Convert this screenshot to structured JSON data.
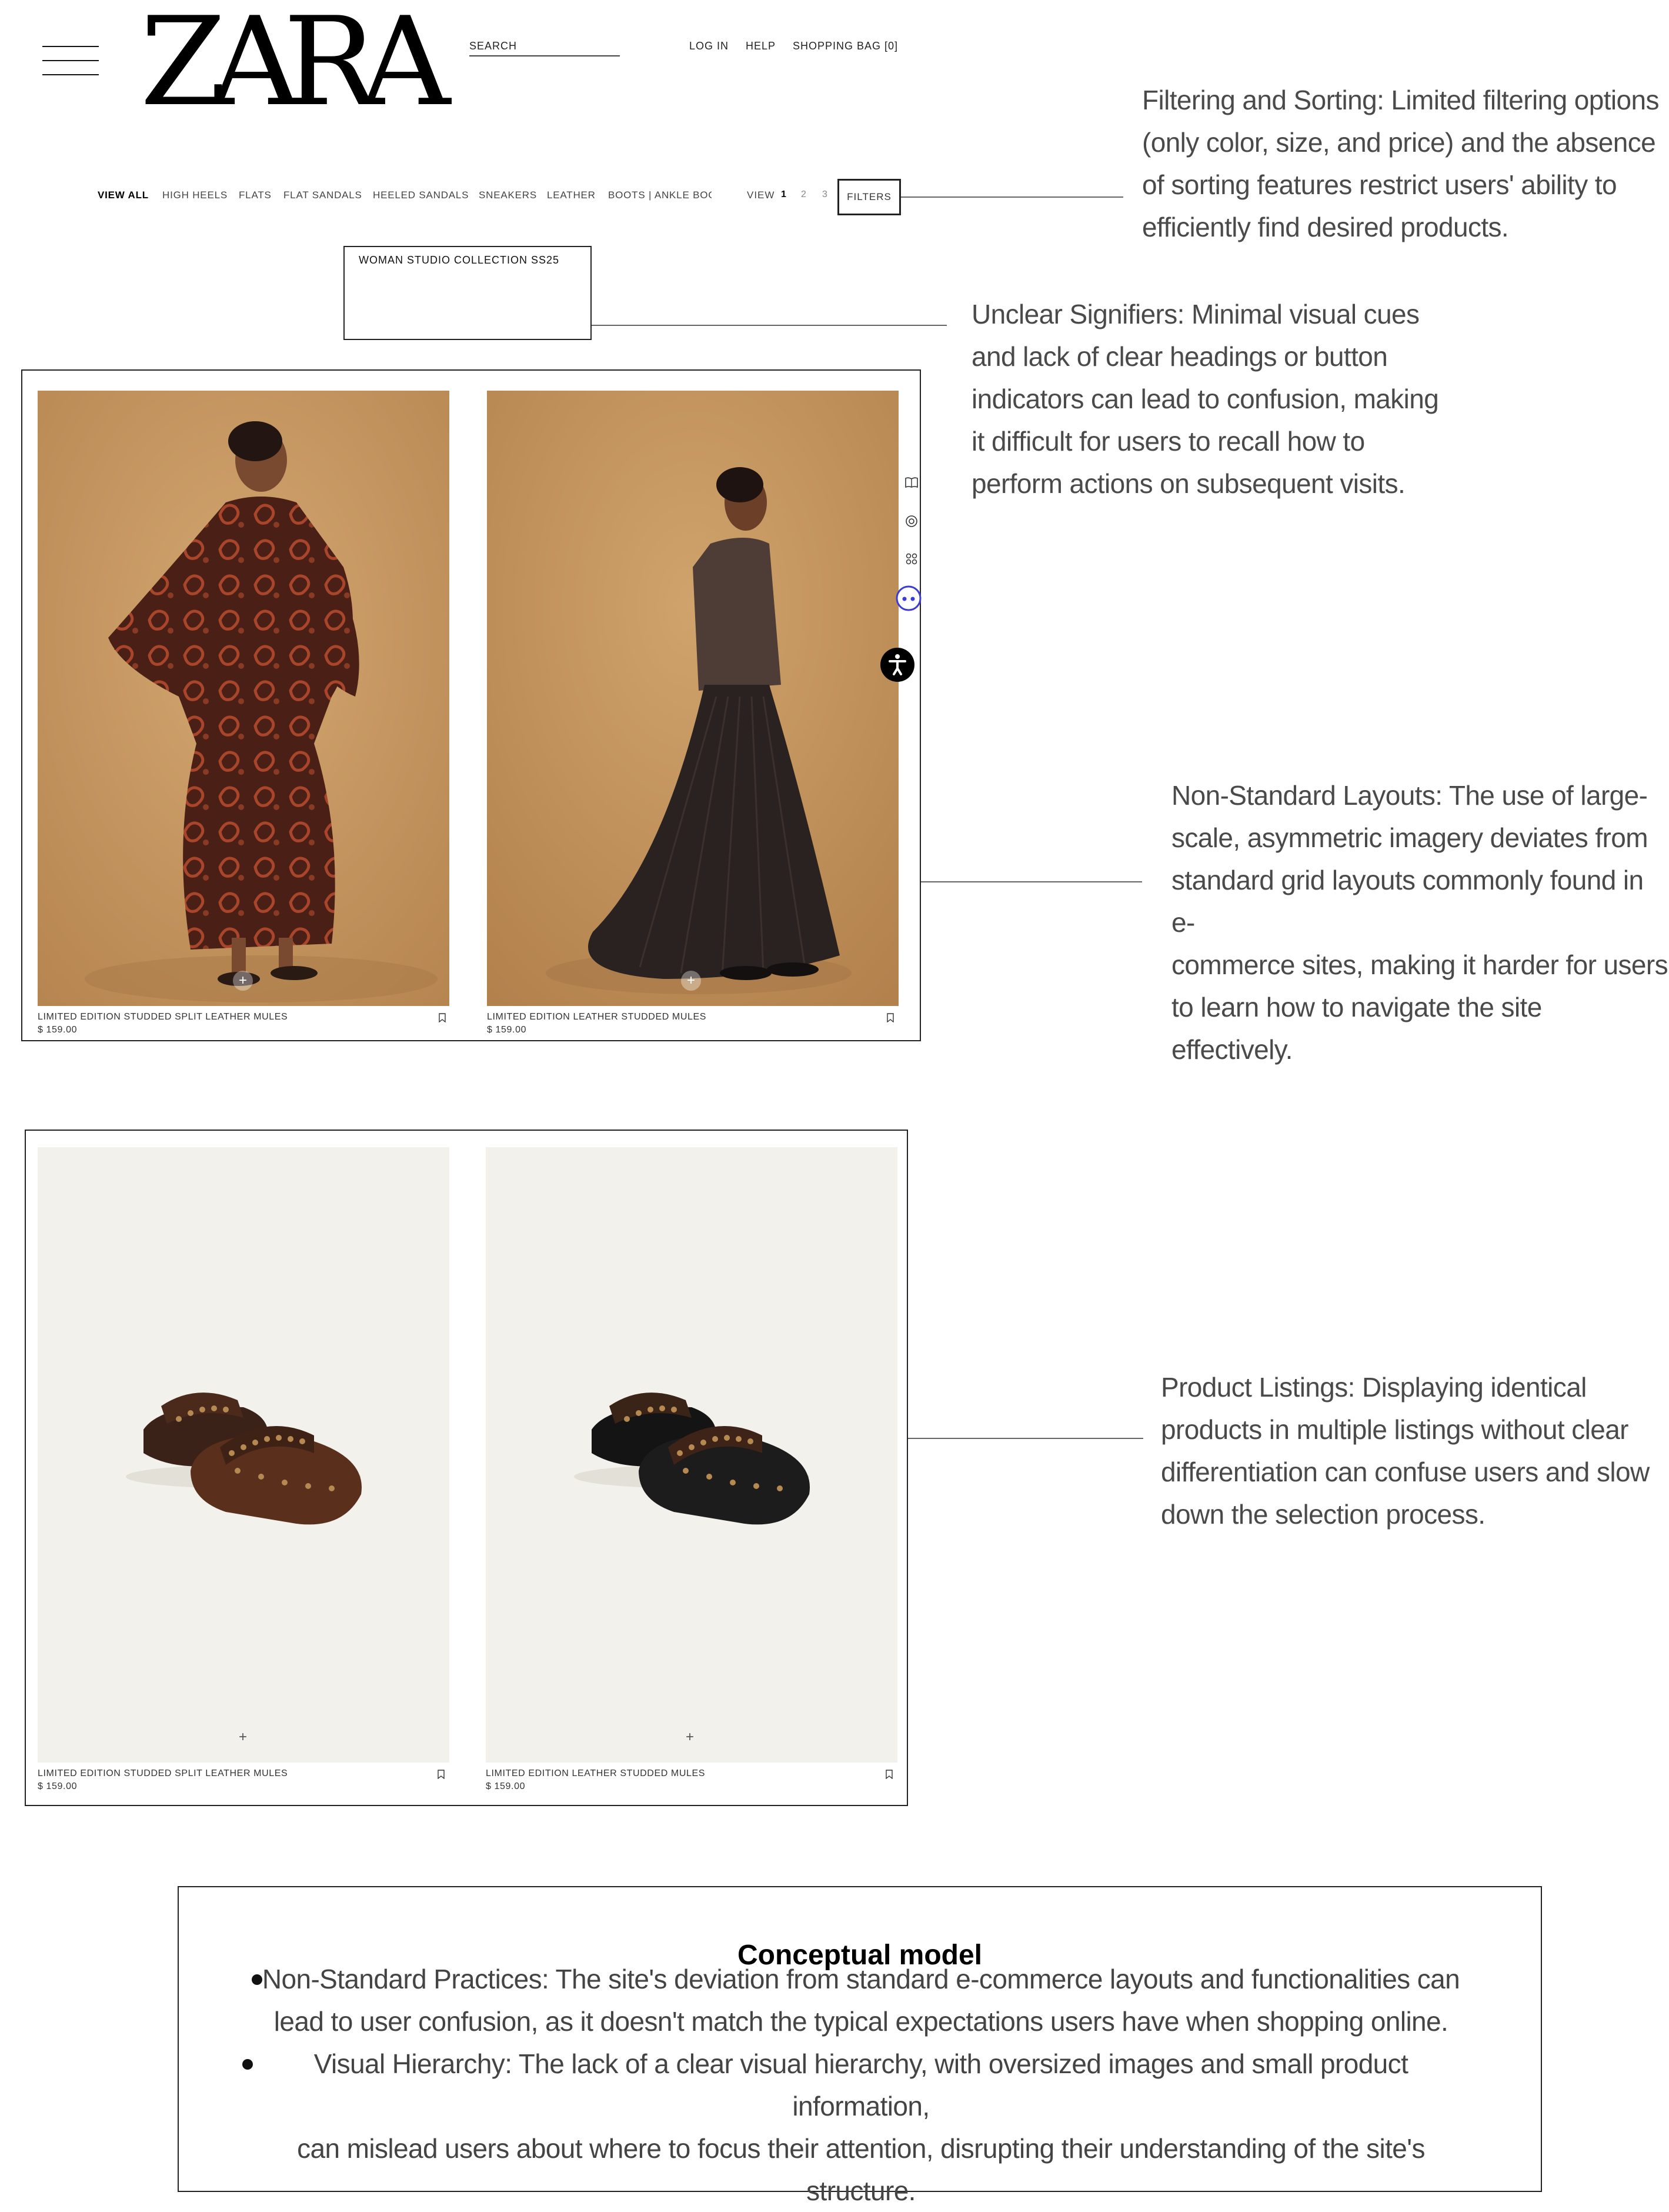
{
  "header": {
    "logo": "ZARA",
    "search_label": "SEARCH",
    "links": [
      "LOG IN",
      "HELP",
      "SHOPPING BAG [0]"
    ]
  },
  "categories": [
    "VIEW ALL",
    "HIGH HEELS",
    "FLATS",
    "FLAT SANDALS",
    "HEELED SANDALS",
    "SNEAKERS",
    "LEATHER",
    "BOOTS | ANKLE BOC"
  ],
  "view": {
    "label": "VIEW",
    "pages": [
      "1",
      "2",
      "3"
    ],
    "current_page": "1",
    "filters_label": "FILTERS"
  },
  "collection": {
    "title": "WOMAN STUDIO COLLECTION SS25"
  },
  "products_top": [
    {
      "name": "LIMITED EDITION STUDDED SPLIT LEATHER MULES",
      "price": "$ 159.00"
    },
    {
      "name": "LIMITED EDITION LEATHER STUDDED MULES",
      "price": "$ 159.00"
    }
  ],
  "products_bottom": [
    {
      "name": "LIMITED EDITION STUDDED SPLIT LEATHER MULES",
      "price": "$ 159.00"
    },
    {
      "name": "LIMITED EDITION LEATHER STUDDED MULES",
      "price": "$ 159.00"
    }
  ],
  "icons": {
    "menu": "hamburger-menu-icon",
    "bookmark": "bookmark-icon",
    "plus": "plus-icon",
    "book": "book-icon",
    "target": "target-icon",
    "grid": "grid-icon",
    "face": "face-icon",
    "accessibility": "accessibility-icon"
  },
  "annotations": {
    "filtering": [
      "Filtering and Sorting: Limited filtering options",
      "(only color, size, and price) and the absence",
      "of sorting features restrict users' ability to",
      "efficiently find desired products."
    ],
    "signifiers": [
      "Unclear Signifiers: Minimal visual cues",
      "and lack of clear headings or button",
      "indicators can lead to confusion, making",
      "it difficult for users to recall how to",
      "perform actions on subsequent visits."
    ],
    "layouts": [
      "Non-Standard Layouts: The use of large-",
      "scale, asymmetric imagery deviates from",
      "standard grid layouts commonly found in e-",
      "commerce sites, making it harder for users",
      "to learn how to navigate the site effectively."
    ],
    "listings": [
      "Product Listings: Displaying identical",
      "products in multiple listings without clear",
      "differentiation can confuse users and slow",
      "down the selection process."
    ]
  },
  "conceptual_model": {
    "title": "Conceptual model",
    "item1": [
      "Non-Standard Practices: The site's deviation from standard e-commerce layouts and functionalities can",
      "lead to user confusion, as it doesn't match the typical expectations users have when shopping online."
    ],
    "item2": [
      "Visual Hierarchy: The lack of a clear visual hierarchy, with oversized images and small product information,",
      "can mislead users about where to focus their attention, disrupting their understanding of the site's",
      "structure."
    ]
  },
  "colors": {
    "sand": "#c79a63",
    "dress": "#4a1f16",
    "dress_pattern": "#a8452a",
    "studio_bg": "#f3f1ec",
    "annotation_text": "#4a4a4a"
  }
}
